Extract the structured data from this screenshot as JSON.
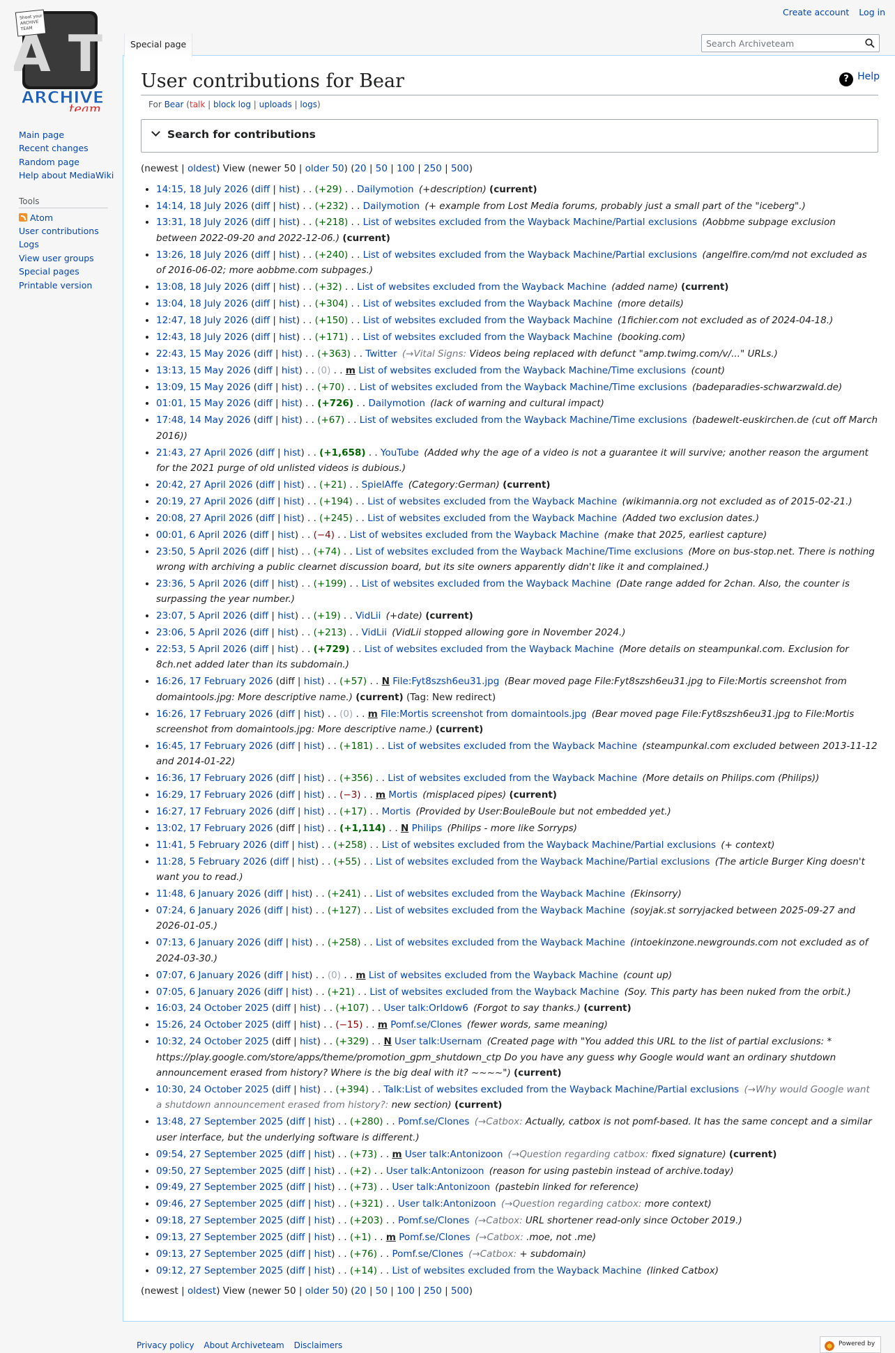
{
  "personal_tools": {
    "create_account": "Create account",
    "log_in": "Log in"
  },
  "logo": {
    "top_text": "A T",
    "bottom_text": "ARCHIVE",
    "script_text": "team",
    "tag_lines": [
      "Shoot your",
      "ARCHIVE",
      "TEAM"
    ]
  },
  "sidebar": {
    "nav": [
      "Main page",
      "Recent changes",
      "Random page",
      "Help about MediaWiki"
    ],
    "tools_heading": "Tools",
    "tools": [
      "Atom",
      "User contributions",
      "Logs",
      "View user groups",
      "Special pages",
      "Printable version"
    ]
  },
  "tabs": {
    "special_page": "Special page"
  },
  "search": {
    "placeholder": "Search Archiveteam"
  },
  "page": {
    "title": "User contributions for Bear",
    "help": "Help",
    "sub": {
      "for": "For",
      "user": "Bear",
      "talk": "talk",
      "block_log": "block log",
      "uploads": "uploads",
      "logs": "logs"
    },
    "search_form_label": "Search for contributions"
  },
  "nav": {
    "newest": "newest",
    "oldest": "oldest",
    "view": "View",
    "newer": "newer 50",
    "older": "older 50",
    "limits": [
      "20",
      "50",
      "100",
      "250",
      "500"
    ]
  },
  "contributions": [
    {
      "t": "14:15, 18 July 2026",
      "diff": "diff",
      "hist": "hist",
      "size": "(+29)",
      "sc": "pos",
      "flag": "",
      "title": "Dailymotion",
      "ac": "",
      "comment": "(+description)",
      "extra": "",
      "current": "(current)"
    },
    {
      "t": "14:14, 18 July 2026",
      "diff": "diff",
      "hist": "hist",
      "size": "(+232)",
      "sc": "pos",
      "flag": "",
      "title": "Dailymotion",
      "ac": "",
      "comment": "(+ example from Lost Media forums, probably just a small part of the \"iceberg\".)",
      "extra": "",
      "current": ""
    },
    {
      "t": "13:31, 18 July 2026",
      "diff": "diff",
      "hist": "hist",
      "size": "(+218)",
      "sc": "pos",
      "flag": "",
      "title": "List of websites excluded from the Wayback Machine/Partial exclusions",
      "ac": "",
      "comment": "(Aobbme subpage exclusion between 2022-09-20 and 2022-12-06.)",
      "extra": "",
      "current": "(current)"
    },
    {
      "t": "13:26, 18 July 2026",
      "diff": "diff",
      "hist": "hist",
      "size": "(+240)",
      "sc": "pos",
      "flag": "",
      "title": "List of websites excluded from the Wayback Machine/Partial exclusions",
      "ac": "",
      "comment": "(angelfire.com/md not excluded as of 2016-06-02; more aobbme.com subpages.)",
      "extra": "",
      "current": ""
    },
    {
      "t": "13:08, 18 July 2026",
      "diff": "diff",
      "hist": "hist",
      "size": "(+32)",
      "sc": "pos",
      "flag": "",
      "title": "List of websites excluded from the Wayback Machine",
      "ac": "",
      "comment": "(added name)",
      "extra": "",
      "current": "(current)"
    },
    {
      "t": "13:04, 18 July 2026",
      "diff": "diff",
      "hist": "hist",
      "size": "(+304)",
      "sc": "pos",
      "flag": "",
      "title": "List of websites excluded from the Wayback Machine",
      "ac": "",
      "comment": "(more details)",
      "extra": "",
      "current": ""
    },
    {
      "t": "12:47, 18 July 2026",
      "diff": "diff",
      "hist": "hist",
      "size": "(+150)",
      "sc": "pos",
      "flag": "",
      "title": "List of websites excluded from the Wayback Machine",
      "ac": "",
      "comment": "(1fichier.com not excluded as of 2024-04-18.)",
      "extra": "",
      "current": ""
    },
    {
      "t": "12:43, 18 July 2026",
      "diff": "diff",
      "hist": "hist",
      "size": "(+171)",
      "sc": "pos",
      "flag": "",
      "title": "List of websites excluded from the Wayback Machine",
      "ac": "",
      "comment": "(booking.com)",
      "extra": "",
      "current": ""
    },
    {
      "t": "22:43, 15 May 2026",
      "diff": "diff",
      "hist": "hist",
      "size": "(+363)",
      "sc": "pos",
      "flag": "",
      "title": "Twitter",
      "ac": "(→Vital Signs:",
      "comment": "Videos being replaced with defunct \"amp.twimg.com/v/...\" URLs.)",
      "extra": "",
      "current": ""
    },
    {
      "t": "13:13, 15 May 2026",
      "diff": "diff",
      "hist": "hist",
      "size": "(0)",
      "sc": "nul",
      "flag": "m",
      "title": "List of websites excluded from the Wayback Machine/Time exclusions",
      "ac": "",
      "comment": "(count)",
      "extra": "",
      "current": ""
    },
    {
      "t": "13:09, 15 May 2026",
      "diff": "diff",
      "hist": "hist",
      "size": "(+70)",
      "sc": "pos",
      "flag": "",
      "title": "List of websites excluded from the Wayback Machine/Time exclusions",
      "ac": "",
      "comment": "(badeparadies-schwarzwald.de)",
      "extra": "",
      "current": ""
    },
    {
      "t": "01:01, 15 May 2026",
      "diff": "diff",
      "hist": "hist",
      "size": "(+726)",
      "sc": "pos-big",
      "flag": "",
      "title": "Dailymotion",
      "ac": "",
      "comment": "(lack of warning and cultural impact)",
      "extra": "",
      "current": ""
    },
    {
      "t": "17:48, 14 May 2026",
      "diff": "diff",
      "hist": "hist",
      "size": "(+67)",
      "sc": "pos",
      "flag": "",
      "title": "List of websites excluded from the Wayback Machine/Time exclusions",
      "ac": "",
      "comment": "(badewelt-euskirchen.de (cut off March 2016))",
      "extra": "",
      "current": ""
    },
    {
      "t": "21:43, 27 April 2026",
      "diff": "diff",
      "hist": "hist",
      "size": "(+1,658)",
      "sc": "pos-big",
      "flag": "",
      "title": "YouTube",
      "ac": "",
      "comment": "(Added why the age of a video is not a guarantee it will survive; another reason the argument for the 2021 purge of old unlisted videos is dubious.)",
      "extra": "",
      "current": ""
    },
    {
      "t": "20:42, 27 April 2026",
      "diff": "diff",
      "hist": "hist",
      "size": "(+21)",
      "sc": "pos",
      "flag": "",
      "title": "SpielAffe",
      "ac": "",
      "comment": "(Category:German)",
      "extra": "",
      "current": "(current)"
    },
    {
      "t": "20:19, 27 April 2026",
      "diff": "diff",
      "hist": "hist",
      "size": "(+194)",
      "sc": "pos",
      "flag": "",
      "title": "List of websites excluded from the Wayback Machine",
      "ac": "",
      "comment": "(wikimannia.org not excluded as of 2015-02-21.)",
      "extra": "",
      "current": ""
    },
    {
      "t": "20:08, 27 April 2026",
      "diff": "diff",
      "hist": "hist",
      "size": "(+245)",
      "sc": "pos",
      "flag": "",
      "title": "List of websites excluded from the Wayback Machine",
      "ac": "",
      "comment": "(Added two exclusion dates.)",
      "extra": "",
      "current": ""
    },
    {
      "t": "00:01, 6 April 2026",
      "diff": "diff",
      "hist": "hist",
      "size": "(−4)",
      "sc": "neg",
      "flag": "",
      "title": "List of websites excluded from the Wayback Machine",
      "ac": "",
      "comment": "(make that 2025, earliest capture)",
      "extra": "",
      "current": ""
    },
    {
      "t": "23:50, 5 April 2026",
      "diff": "diff",
      "hist": "hist",
      "size": "(+74)",
      "sc": "pos",
      "flag": "",
      "title": "List of websites excluded from the Wayback Machine/Time exclusions",
      "ac": "",
      "comment": "(More on bus-stop.net. There is nothing wrong with archiving a public clearnet discussion board, but its site owners apparently didn't like it and complained.)",
      "extra": "",
      "current": ""
    },
    {
      "t": "23:36, 5 April 2026",
      "diff": "diff",
      "hist": "hist",
      "size": "(+199)",
      "sc": "pos",
      "flag": "",
      "title": "List of websites excluded from the Wayback Machine",
      "ac": "",
      "comment": "(Date range added for 2chan. Also, the counter is surpassing the year number.)",
      "extra": "",
      "current": ""
    },
    {
      "t": "23:07, 5 April 2026",
      "diff": "diff",
      "hist": "hist",
      "size": "(+19)",
      "sc": "pos",
      "flag": "",
      "title": "VidLii",
      "ac": "",
      "comment": "(+date)",
      "extra": "",
      "current": "(current)"
    },
    {
      "t": "23:06, 5 April 2026",
      "diff": "diff",
      "hist": "hist",
      "size": "(+213)",
      "sc": "pos",
      "flag": "",
      "title": "VidLii",
      "ac": "",
      "comment": "(VidLii stopped allowing gore in November 2024.)",
      "extra": "",
      "current": ""
    },
    {
      "t": "22:53, 5 April 2026",
      "diff": "diff",
      "hist": "hist",
      "size": "(+729)",
      "sc": "pos-big",
      "flag": "",
      "title": "List of websites excluded from the Wayback Machine",
      "ac": "",
      "comment": "(More details on steampunkal.com. Exclusion for 8ch.net added later than its subdomain.)",
      "extra": "",
      "current": ""
    },
    {
      "t": "16:26, 17 February 2026",
      "diff": "",
      "hist": "hist",
      "size": "(+57)",
      "sc": "pos",
      "flag": "N",
      "title": "File:Fyt8szsh6eu31.jpg",
      "ac": "",
      "comment": "(Bear moved page File:Fyt8szsh6eu31.jpg to File:Mortis screenshot from domaintools.jpg: More descriptive name.)",
      "extra": "(Tag: New redirect)",
      "current": "(current)"
    },
    {
      "t": "16:26, 17 February 2026",
      "diff": "diff",
      "hist": "hist",
      "size": "(0)",
      "sc": "nul",
      "flag": "m",
      "title": "File:Mortis screenshot from domaintools.jpg",
      "ac": "",
      "comment": "(Bear moved page File:Fyt8szsh6eu31.jpg to File:Mortis screenshot from domaintools.jpg: More descriptive name.)",
      "extra": "",
      "current": "(current)"
    },
    {
      "t": "16:45, 17 February 2026",
      "diff": "diff",
      "hist": "hist",
      "size": "(+181)",
      "sc": "pos",
      "flag": "",
      "title": "List of websites excluded from the Wayback Machine",
      "ac": "",
      "comment": "(steampunkal.com excluded between 2013-11-12 and 2014-01-22)",
      "extra": "",
      "current": ""
    },
    {
      "t": "16:36, 17 February 2026",
      "diff": "diff",
      "hist": "hist",
      "size": "(+356)",
      "sc": "pos",
      "flag": "",
      "title": "List of websites excluded from the Wayback Machine",
      "ac": "",
      "comment": "(More details on Philips.com (Philips))",
      "extra": "",
      "current": ""
    },
    {
      "t": "16:29, 17 February 2026",
      "diff": "diff",
      "hist": "hist",
      "size": "(−3)",
      "sc": "neg",
      "flag": "m",
      "title": "Mortis",
      "ac": "",
      "comment": "(misplaced pipes)",
      "extra": "",
      "current": "(current)"
    },
    {
      "t": "16:27, 17 February 2026",
      "diff": "diff",
      "hist": "hist",
      "size": "(+17)",
      "sc": "pos",
      "flag": "",
      "title": "Mortis",
      "ac": "",
      "comment": "(Provided by User:BouleBoule but not embedded yet.)",
      "extra": "",
      "current": ""
    },
    {
      "t": "13:02, 17 February 2026",
      "diff": "",
      "hist": "hist",
      "size": "(+1,114)",
      "sc": "pos-big",
      "flag": "N",
      "title": "Philips",
      "ac": "",
      "comment": "(Philips - more like Sorryps)",
      "extra": "",
      "current": ""
    },
    {
      "t": "11:41, 5 February 2026",
      "diff": "diff",
      "hist": "hist",
      "size": "(+258)",
      "sc": "pos",
      "flag": "",
      "title": "List of websites excluded from the Wayback Machine/Partial exclusions",
      "ac": "",
      "comment": "(+ context)",
      "extra": "",
      "current": ""
    },
    {
      "t": "11:28, 5 February 2026",
      "diff": "diff",
      "hist": "hist",
      "size": "(+55)",
      "sc": "pos",
      "flag": "",
      "title": "List of websites excluded from the Wayback Machine/Partial exclusions",
      "ac": "",
      "comment": "(The article Burger King doesn't want you to read.)",
      "extra": "",
      "current": ""
    },
    {
      "t": "11:48, 6 January 2026",
      "diff": "diff",
      "hist": "hist",
      "size": "(+241)",
      "sc": "pos",
      "flag": "",
      "title": "List of websites excluded from the Wayback Machine",
      "ac": "",
      "comment": "(Ekinsorry)",
      "extra": "",
      "current": ""
    },
    {
      "t": "07:24, 6 January 2026",
      "diff": "diff",
      "hist": "hist",
      "size": "(+127)",
      "sc": "pos",
      "flag": "",
      "title": "List of websites excluded from the Wayback Machine",
      "ac": "",
      "comment": "(soyjak.st sorryjacked between 2025-09-27 and 2026-01-05.)",
      "extra": "",
      "current": ""
    },
    {
      "t": "07:13, 6 January 2026",
      "diff": "diff",
      "hist": "hist",
      "size": "(+258)",
      "sc": "pos",
      "flag": "",
      "title": "List of websites excluded from the Wayback Machine",
      "ac": "",
      "comment": "(intoekinzone.newgrounds.com not excluded as of 2024-03-30.)",
      "extra": "",
      "current": ""
    },
    {
      "t": "07:07, 6 January 2026",
      "diff": "diff",
      "hist": "hist",
      "size": "(0)",
      "sc": "nul",
      "flag": "m",
      "title": "List of websites excluded from the Wayback Machine",
      "ac": "",
      "comment": "(count up)",
      "extra": "",
      "current": ""
    },
    {
      "t": "07:05, 6 January 2026",
      "diff": "diff",
      "hist": "hist",
      "size": "(+21)",
      "sc": "pos",
      "flag": "",
      "title": "List of websites excluded from the Wayback Machine",
      "ac": "",
      "comment": "(Soy. This party has been nuked from the orbit.)",
      "extra": "",
      "current": ""
    },
    {
      "t": "16:03, 24 October 2025",
      "diff": "diff",
      "hist": "hist",
      "size": "(+107)",
      "sc": "pos",
      "flag": "",
      "title": "User talk:OrIdow6",
      "ac": "",
      "comment": "(Forgot to say thanks.)",
      "extra": "",
      "current": "(current)"
    },
    {
      "t": "15:26, 24 October 2025",
      "diff": "diff",
      "hist": "hist",
      "size": "(−15)",
      "sc": "neg",
      "flag": "m",
      "title": "Pomf.se/Clones",
      "ac": "",
      "comment": "(fewer words, same meaning)",
      "extra": "",
      "current": ""
    },
    {
      "t": "10:32, 24 October 2025",
      "diff": "",
      "hist": "hist",
      "size": "(+329)",
      "sc": "pos",
      "flag": "N",
      "title": "User talk:Usernam",
      "ac": "",
      "comment": "(Created page with \"You added this URL to the list of partial exclusions: * https://play.google.com/store/apps/theme/promotion_gpm_shutdown_ctp Do you have any guess why Google would want an ordinary shutdown announcement erased from history? Where is the big deal with it? ~~~~\")",
      "extra": "",
      "current": "(current)"
    },
    {
      "t": "10:30, 24 October 2025",
      "diff": "diff",
      "hist": "hist",
      "size": "(+394)",
      "sc": "pos",
      "flag": "",
      "title": "Talk:List of websites excluded from the Wayback Machine/Partial exclusions",
      "ac": "(→Why would Google want a shutdown announcement erased from history?:",
      "comment": "new section)",
      "extra": "",
      "current": "(current)"
    },
    {
      "t": "13:48, 27 September 2025",
      "diff": "diff",
      "hist": "hist",
      "size": "(+280)",
      "sc": "pos",
      "flag": "",
      "title": "Pomf.se/Clones",
      "ac": "(→Catbox:",
      "comment": "Actually, catbox is not pomf-based. It has the same concept and a similar user interface, but the underlying software is different.)",
      "extra": "",
      "current": ""
    },
    {
      "t": "09:54, 27 September 2025",
      "diff": "diff",
      "hist": "hist",
      "size": "(+73)",
      "sc": "pos",
      "flag": "m",
      "title": "User talk:Antonizoon",
      "ac": "(→Question regarding catbox:",
      "comment": "fixed signature)",
      "extra": "",
      "current": "(current)"
    },
    {
      "t": "09:50, 27 September 2025",
      "diff": "diff",
      "hist": "hist",
      "size": "(+2)",
      "sc": "pos",
      "flag": "",
      "title": "User talk:Antonizoon",
      "ac": "",
      "comment": "(reason for using pastebin instead of archive.today)",
      "extra": "",
      "current": ""
    },
    {
      "t": "09:49, 27 September 2025",
      "diff": "diff",
      "hist": "hist",
      "size": "(+73)",
      "sc": "pos",
      "flag": "",
      "title": "User talk:Antonizoon",
      "ac": "",
      "comment": "(pastebin linked for reference)",
      "extra": "",
      "current": ""
    },
    {
      "t": "09:46, 27 September 2025",
      "diff": "diff",
      "hist": "hist",
      "size": "(+321)",
      "sc": "pos",
      "flag": "",
      "title": "User talk:Antonizoon",
      "ac": "(→Question regarding catbox:",
      "comment": "more context)",
      "extra": "",
      "current": ""
    },
    {
      "t": "09:18, 27 September 2025",
      "diff": "diff",
      "hist": "hist",
      "size": "(+203)",
      "sc": "pos",
      "flag": "",
      "title": "Pomf.se/Clones",
      "ac": "(→Catbox:",
      "comment": "URL shortener read-only since October 2019.)",
      "extra": "",
      "current": ""
    },
    {
      "t": "09:13, 27 September 2025",
      "diff": "diff",
      "hist": "hist",
      "size": "(+1)",
      "sc": "pos",
      "flag": "m",
      "title": "Pomf.se/Clones",
      "ac": "(→Catbox:",
      "comment": ".moe, not .me)",
      "extra": "",
      "current": ""
    },
    {
      "t": "09:13, 27 September 2025",
      "diff": "diff",
      "hist": "hist",
      "size": "(+76)",
      "sc": "pos",
      "flag": "",
      "title": "Pomf.se/Clones",
      "ac": "(→Catbox:",
      "comment": "+ subdomain)",
      "extra": "",
      "current": ""
    },
    {
      "t": "09:12, 27 September 2025",
      "diff": "diff",
      "hist": "hist",
      "size": "(+14)",
      "sc": "pos",
      "flag": "",
      "title": "List of websites excluded from the Wayback Machine",
      "ac": "",
      "comment": "(linked Catbox)",
      "extra": "",
      "current": ""
    }
  ],
  "footer": {
    "links": [
      "Privacy policy",
      "About Archiveteam",
      "Disclaimers"
    ],
    "powered": "Powered by"
  }
}
